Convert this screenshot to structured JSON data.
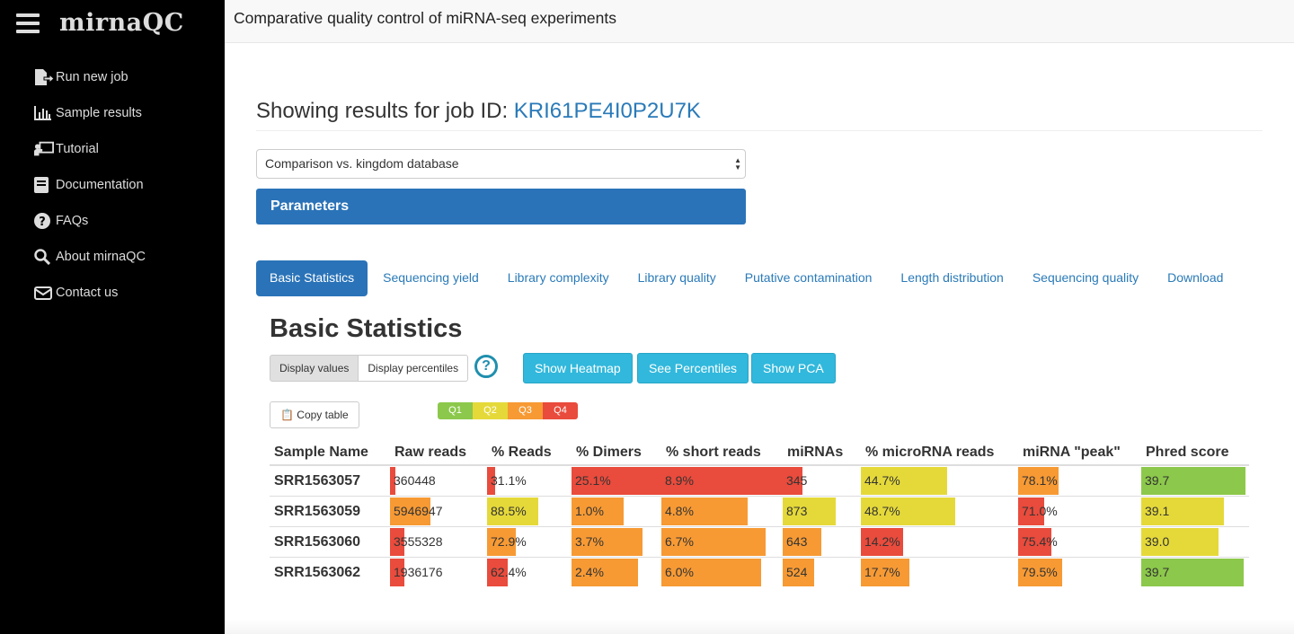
{
  "sidebar": {
    "brand": "mirnaQC",
    "items": [
      {
        "label": "Run new job",
        "icon": "file-arrow-icon"
      },
      {
        "label": "Sample results",
        "icon": "bar-chart-icon"
      },
      {
        "label": "Tutorial",
        "icon": "presentation-icon"
      },
      {
        "label": "Documentation",
        "icon": "book-icon"
      },
      {
        "label": "FAQs",
        "icon": "question-circle-icon"
      },
      {
        "label": "About mirnaQC",
        "icon": "search-icon"
      },
      {
        "label": "Contact us",
        "icon": "envelope-icon"
      }
    ]
  },
  "header": {
    "title": "Comparative quality control of miRNA-seq experiments"
  },
  "job": {
    "heading": "Showing results for job ID:",
    "id": "KRI61PE4I0P2U7K"
  },
  "select": {
    "value": "Comparison vs. kingdom database"
  },
  "parameters_label": "Parameters",
  "tabs": [
    "Basic Statistics",
    "Sequencing yield",
    "Library complexity",
    "Library quality",
    "Putative contamination",
    "Length distribution",
    "Sequencing quality",
    "Download"
  ],
  "section": {
    "title": "Basic Statistics",
    "display_values": "Display values",
    "display_percentiles": "Display percentiles",
    "help": "?",
    "buttons": [
      "Show Heatmap",
      "See Percentiles",
      "Show PCA"
    ],
    "copy_table": "Copy table"
  },
  "legend": [
    {
      "label": "Q1",
      "color": "#8cc84b"
    },
    {
      "label": "Q2",
      "color": "#e5d93a"
    },
    {
      "label": "Q3",
      "color": "#f79a34"
    },
    {
      "label": "Q4",
      "color": "#e94b3c"
    }
  ],
  "table": {
    "columns": [
      "Sample Name",
      "Raw reads",
      "% Reads",
      "% Dimers",
      "% short reads",
      "miRNAs",
      "% microRNA reads",
      "miRNA \"peak\"",
      "Phred score"
    ],
    "rows": [
      {
        "name": "SRR1563057",
        "cells": [
          {
            "text": "360448",
            "fill": 0.06,
            "q": 4
          },
          {
            "text": "31.1%",
            "fill": 0.1,
            "q": 4
          },
          {
            "text": "25.1%",
            "fill": 1.0,
            "q": 4
          },
          {
            "text": "8.9%",
            "fill": 1.0,
            "q": 4
          },
          {
            "text": "345",
            "fill": 0.25,
            "q": 4
          },
          {
            "text": "44.7%",
            "fill": 0.55,
            "q": 2
          },
          {
            "text": "78.1%",
            "fill": 0.33,
            "q": 3
          },
          {
            "text": "39.7",
            "fill": 0.97,
            "q": 1
          }
        ]
      },
      {
        "name": "SRR1563059",
        "cells": [
          {
            "text": "5946947",
            "fill": 0.42,
            "q": 3
          },
          {
            "text": "88.5%",
            "fill": 0.61,
            "q": 2
          },
          {
            "text": "1.0%",
            "fill": 0.58,
            "q": 3
          },
          {
            "text": "4.8%",
            "fill": 0.71,
            "q": 3
          },
          {
            "text": "873",
            "fill": 0.68,
            "q": 2
          },
          {
            "text": "48.7%",
            "fill": 0.6,
            "q": 2
          },
          {
            "text": "71.0%",
            "fill": 0.21,
            "q": 4
          },
          {
            "text": "39.1",
            "fill": 0.77,
            "q": 2
          }
        ]
      },
      {
        "name": "SRR1563060",
        "cells": [
          {
            "text": "3555328",
            "fill": 0.15,
            "q": 4
          },
          {
            "text": "72.9%",
            "fill": 0.34,
            "q": 3
          },
          {
            "text": "3.7%",
            "fill": 0.79,
            "q": 3
          },
          {
            "text": "6.7%",
            "fill": 0.86,
            "q": 3
          },
          {
            "text": "643",
            "fill": 0.49,
            "q": 3
          },
          {
            "text": "14.2%",
            "fill": 0.27,
            "q": 4
          },
          {
            "text": "75.4%",
            "fill": 0.27,
            "q": 4
          },
          {
            "text": "39.0",
            "fill": 0.72,
            "q": 2
          }
        ]
      },
      {
        "name": "SRR1563062",
        "cells": [
          {
            "text": "1936176",
            "fill": 0.15,
            "q": 4
          },
          {
            "text": "62.4%",
            "fill": 0.24,
            "q": 4
          },
          {
            "text": "2.4%",
            "fill": 0.74,
            "q": 3
          },
          {
            "text": "6.0%",
            "fill": 0.82,
            "q": 3
          },
          {
            "text": "524",
            "fill": 0.4,
            "q": 3
          },
          {
            "text": "17.7%",
            "fill": 0.31,
            "q": 3
          },
          {
            "text": "79.5%",
            "fill": 0.36,
            "q": 3
          },
          {
            "text": "39.7",
            "fill": 0.95,
            "q": 1
          }
        ]
      }
    ]
  }
}
